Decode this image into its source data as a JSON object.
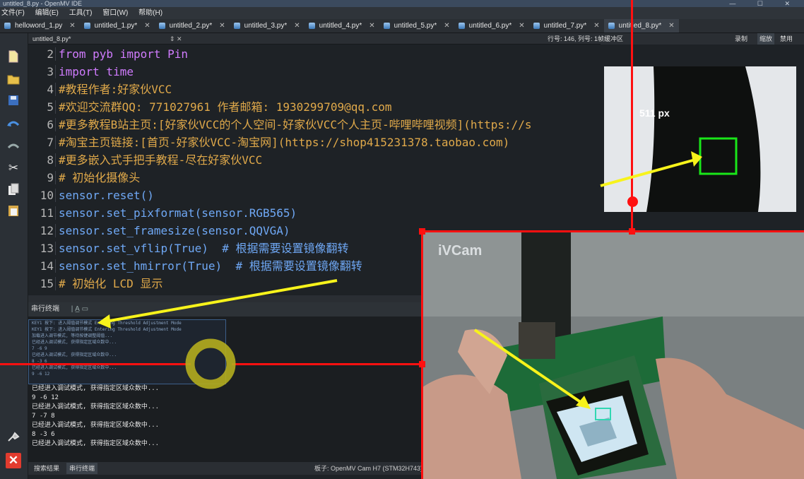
{
  "window": {
    "title": "untitled_8.py - OpenMV IDE"
  },
  "menu": [
    "文件(F)",
    "编辑(E)",
    "工具(T)",
    "窗口(W)",
    "帮助(H)"
  ],
  "tabs": [
    {
      "label": "helloword_1.py",
      "active": false
    },
    {
      "label": "untitled_1.py*",
      "active": false
    },
    {
      "label": "untitled_2.py*",
      "active": false
    },
    {
      "label": "untitled_3.py*",
      "active": false
    },
    {
      "label": "untitled_4.py*",
      "active": false
    },
    {
      "label": "untitled_5.py*",
      "active": false
    },
    {
      "label": "untitled_6.py*",
      "active": false
    },
    {
      "label": "untitled_7.py*",
      "active": false
    },
    {
      "label": "untitled_8.py*",
      "active": true
    }
  ],
  "editor": {
    "filename": "untitled_8.py*",
    "position": "行号: 146, 列号: 1",
    "frame_buffer_label": "帧缓冲区",
    "fb_controls": [
      "录制",
      "缩放",
      "禁用"
    ],
    "lines": [
      {
        "n": "2",
        "text": "from pyb import Pin",
        "kind": "import"
      },
      {
        "n": "3",
        "text": "import time",
        "kind": "import"
      },
      {
        "n": "4",
        "text": "#教程作者:好家伙VCC",
        "kind": "comment"
      },
      {
        "n": "5",
        "text": "#欢迎交流群QQ: 771027961 作者邮箱: 1930299709@qq.com",
        "kind": "comment"
      },
      {
        "n": "6",
        "text": "#更多教程B站主页:[好家伙VCC的个人空间-好家伙VCC个人主页-哔哩哔哩视频](https://s",
        "kind": "comment"
      },
      {
        "n": "7",
        "text": "#淘宝主页链接:[首页-好家伙VCC-淘宝网](https://shop415231378.taobao.com)",
        "kind": "comment"
      },
      {
        "n": "8",
        "text": "#更多嵌入式手把手教程-尽在好家伙VCC",
        "kind": "comment"
      },
      {
        "n": "9",
        "text": "# 初始化摄像头",
        "kind": "comment"
      },
      {
        "n": "10",
        "text": "sensor.reset()",
        "kind": "call"
      },
      {
        "n": "11",
        "text": "sensor.set_pixformat(sensor.RGB565)",
        "kind": "call"
      },
      {
        "n": "12",
        "text": "sensor.set_framesize(sensor.QQVGA)",
        "kind": "call"
      },
      {
        "n": "13",
        "text": "sensor.set_vflip(True)  # 根据需要设置镜像翻转",
        "kind": "call"
      },
      {
        "n": "14",
        "text": "sensor.set_hmirror(True)  # 根据需要设置镜像翻转",
        "kind": "call"
      },
      {
        "n": "15",
        "text": "# 初始化 LCD 显示",
        "kind": "comment"
      }
    ]
  },
  "serial": {
    "title": "串行终端",
    "ghost_lines": [
      "KEY1 按下: 进入阈值调节模式 Entering Threshold Adjustment Mode",
      "KEY1 按下: 进入阈值调节模式 Entering Threshold Adjustment Mode",
      "加载进入调节模式, 等待按键调整阈值...",
      "已经进入调试模式, 获得指定区域众数中...",
      "7 -6 9",
      "已经进入调试模式, 获得指定区域众数中...",
      "8 -3 6",
      "已经进入调试模式, 获得指定区域众数中...",
      "9 -6 12"
    ],
    "lines": [
      "已经进入调试模式, 获得指定区域众数中...",
      "9 -6 12",
      "已经进入调试模式, 获得指定区域众数中...",
      "7 -7 8",
      "已经进入调试模式, 获得指定区域众数中...",
      "8 -3 6",
      "已经进入调试模式, 获得指定区域众数中..."
    ]
  },
  "status": {
    "tabs": [
      "搜索结果",
      "串行终端"
    ],
    "active_tab": 1,
    "board": "板子: OpenMV Cam H7 (STM32H743)"
  },
  "frame_buffer": {
    "overlay_text": "511 px"
  },
  "camera": {
    "watermark": "iVCam"
  },
  "colors": {
    "marker": "#ff1010",
    "arrow": "#f7f31b",
    "roi": "#19e619",
    "ring": "#b4ad1e"
  }
}
